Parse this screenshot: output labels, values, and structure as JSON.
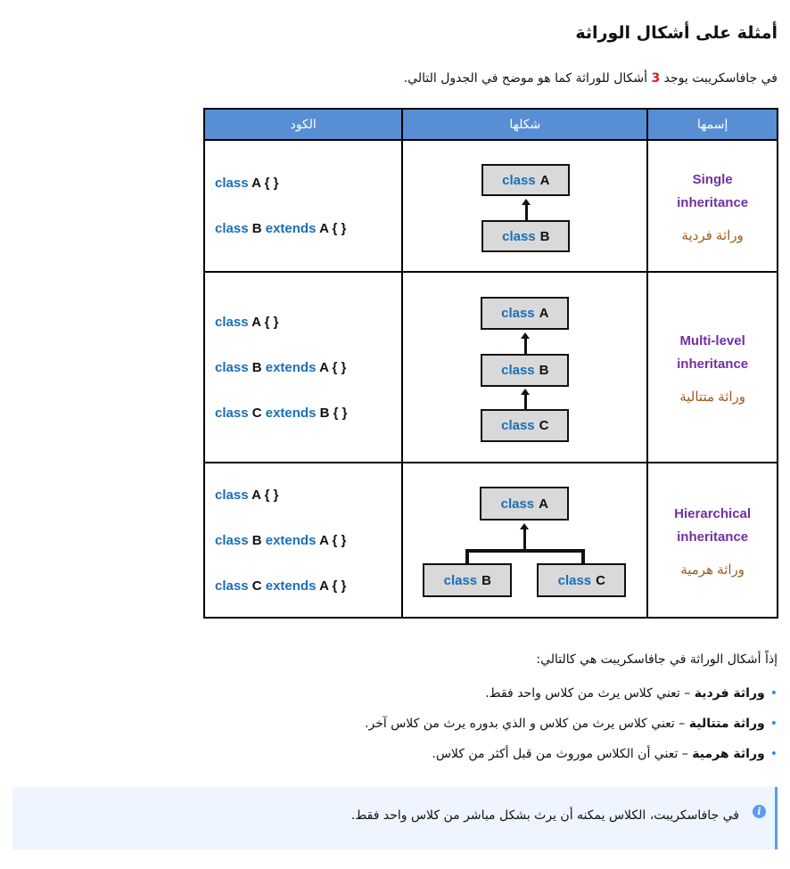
{
  "title": "أمثلة على أشكال الوراثة",
  "intro": {
    "before": "في جافاسكريبت يوجد ",
    "number": "3",
    "after": " أشكال للوراثة كما هو موضح في الجدول التالي."
  },
  "table": {
    "headers": {
      "code": "الكود",
      "shape": "شكلها",
      "name": "إسمها"
    },
    "keywords": {
      "class": "class",
      "extends": "extends"
    },
    "rows": [
      {
        "name_en_1": "Single",
        "name_en_2": "inheritance",
        "name_ar": "وراثة فردية",
        "code": [
          {
            "kw1": "class",
            "rest": "A { }"
          },
          {
            "kw1": "class",
            "cls": "B",
            "kw2": "extends",
            "rest": "A { }"
          }
        ],
        "diagram": [
          "A",
          "B"
        ]
      },
      {
        "name_en_1": "Multi-level",
        "name_en_2": "inheritance",
        "name_ar": "وراثة متتالية",
        "code": [
          {
            "kw1": "class",
            "rest": "A { }"
          },
          {
            "kw1": "class",
            "cls": "B",
            "kw2": "extends",
            "rest": "A { }"
          },
          {
            "kw1": "class",
            "cls": "C",
            "kw2": "extends",
            "rest": "B { }"
          }
        ],
        "diagram": [
          "A",
          "B",
          "C"
        ]
      },
      {
        "name_en_1": "Hierarchical",
        "name_en_2": "inheritance",
        "name_ar": "وراثة هرمية",
        "code": [
          {
            "kw1": "class",
            "rest": "A { }"
          },
          {
            "kw1": "class",
            "cls": "B",
            "kw2": "extends",
            "rest": "A { }"
          },
          {
            "kw1": "class",
            "cls": "C",
            "kw2": "extends",
            "rest": "A { }"
          }
        ],
        "diagram": [
          "A",
          "B",
          "C"
        ]
      }
    ]
  },
  "summary": "إذاً أشكال الوراثة في جافاسكريبت هي كالتالي:",
  "forms": [
    {
      "term": "وراثة فردية",
      "desc": " – تعني كلاس يرث من كلاس واحد فقط."
    },
    {
      "term": "وراثة متتالية",
      "desc": " – تعني كلاس يرث من كلاس و الذي بدوره يرث من كلاس آخر."
    },
    {
      "term": "وراثة هرمية",
      "desc": " – تعني أن الكلاس موروث من قبل أكثر من كلاس."
    }
  ],
  "note": {
    "icon": "info-icon",
    "icon_glyph": "i",
    "text": "في جافاسكريبت، الكلاس يمكنه أن يرث بشكل مباشر من كلاس واحد فقط."
  },
  "colors": {
    "header_bg": "#578ed4",
    "keyword": "#1a6fb5",
    "name_en": "#7030a0",
    "name_ar": "#9b5b1e",
    "highlight_number": "#e01b1b",
    "note_bg": "#eef5ff",
    "note_accent": "#5a9cf0"
  }
}
